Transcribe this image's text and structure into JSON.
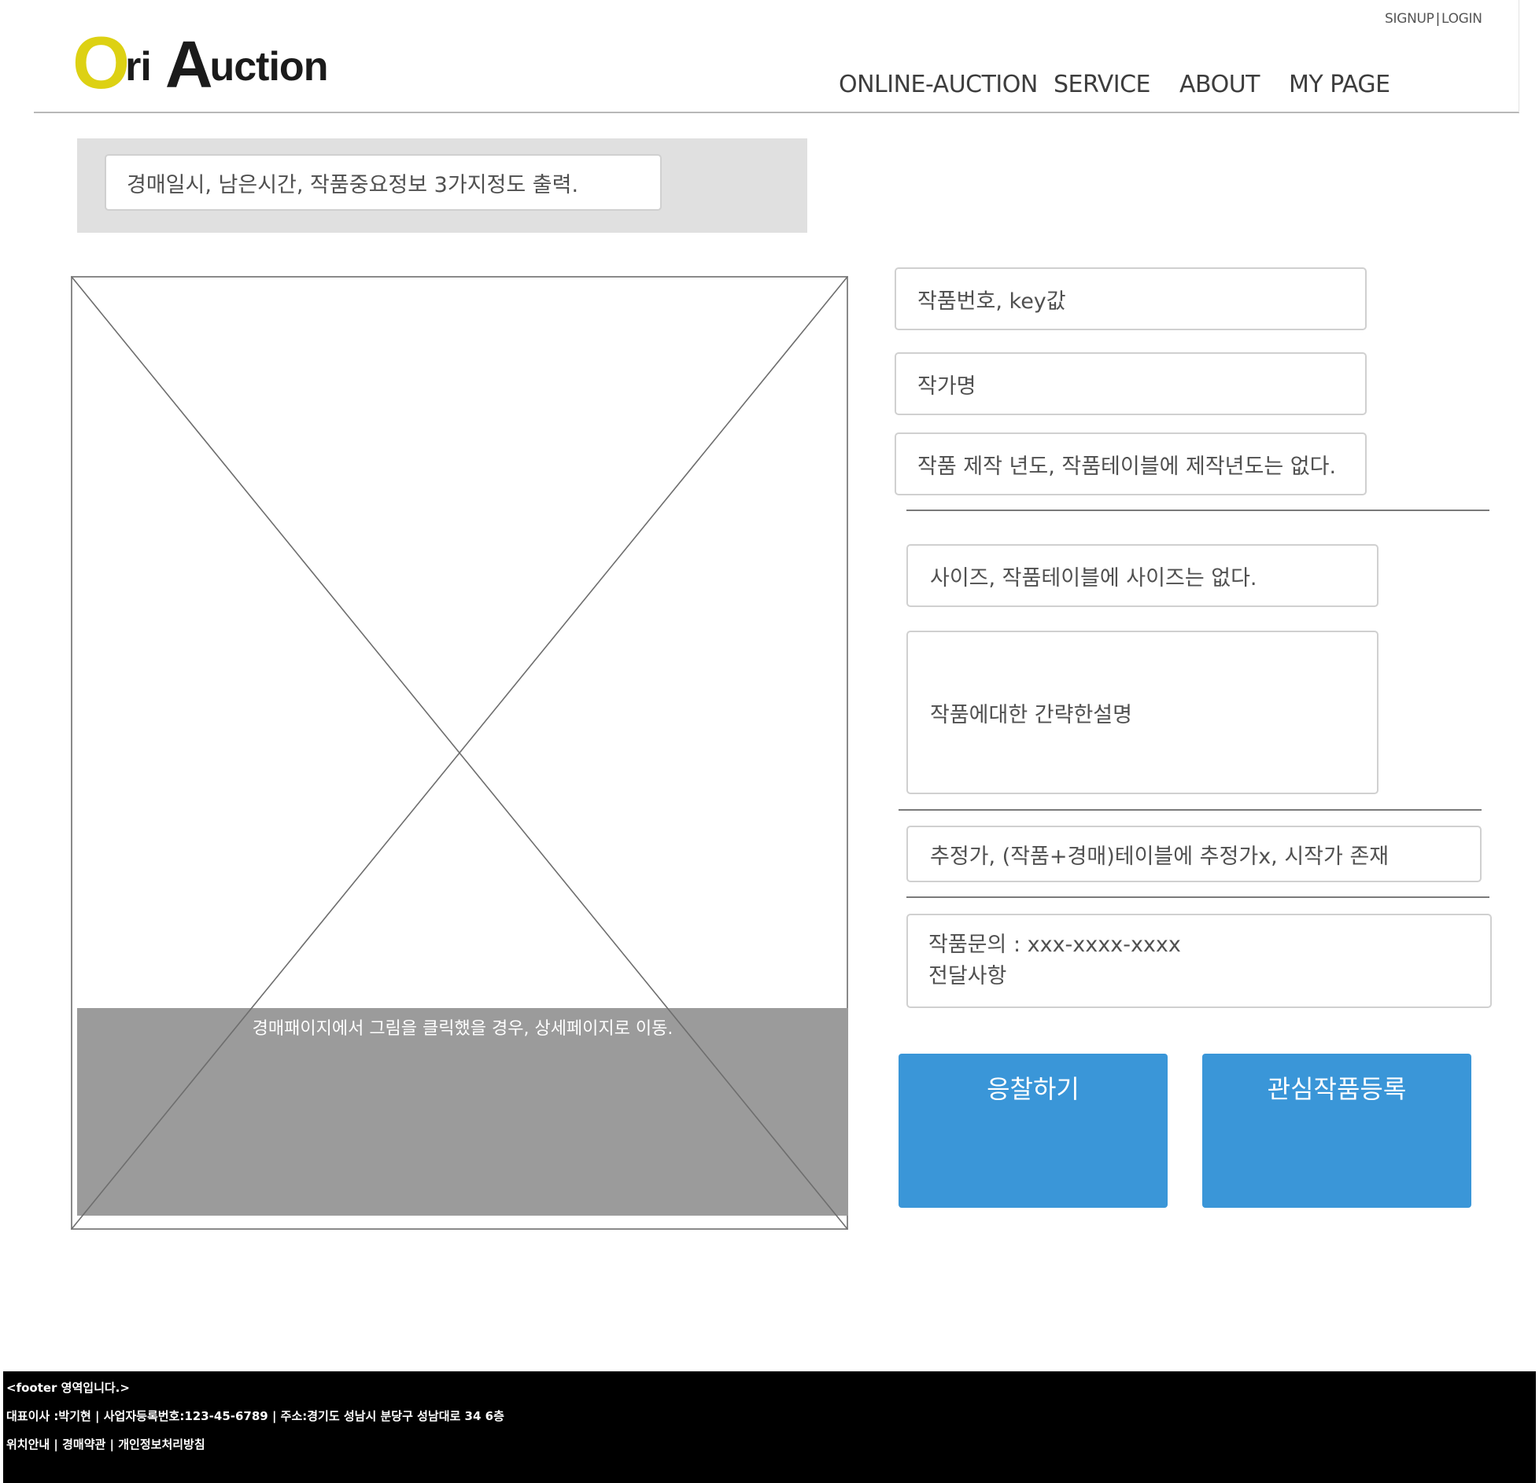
{
  "header": {
    "auth": {
      "signup": "SIGNUP",
      "separator": "|",
      "login": "LOGIN"
    },
    "logo": {
      "part1": "O",
      "part2": "ri",
      "part3": "A",
      "part4": "uction",
      "accent_color": "#ddd113"
    },
    "nav": [
      "ONLINE-AUCTION",
      "SERVICE",
      "ABOUT",
      "MY PAGE"
    ]
  },
  "summary": {
    "text": "경매일시, 남은시간, 작품중요정보 3가지정도 출력."
  },
  "image": {
    "overlay_text": "경매패이지에서 그림을 클릭했을 경우, 상세페이지로 이동."
  },
  "details": {
    "artwork_number": "작품번호, key값",
    "artist": "작가명",
    "year": "작품 제작 년도, 작품테이블에 제작년도는 없다.",
    "size": "사이즈, 작품테이블에 사이즈는 없다.",
    "description": "작품에대한 간략한설명",
    "estimate": "추정가, (작품+경매)테이블에 추정가x, 시작가 존재",
    "inquiry_line1": "작품문의 : xxx-xxxx-xxxx",
    "inquiry_line2": "전달사항"
  },
  "buttons": {
    "bid": "응찰하기",
    "favorite": "관심작품등록",
    "color": "#3a96d8"
  },
  "footer": {
    "line1": "<footer 영역입니다.>",
    "line2": "대표이사 :박기현 | 사업자등록번호:123-45-6789 | 주소:경기도 성남시 분당구 성남대로 34 6층",
    "line3": "위치안내 | 경매약관 | 개인정보처리방침"
  }
}
